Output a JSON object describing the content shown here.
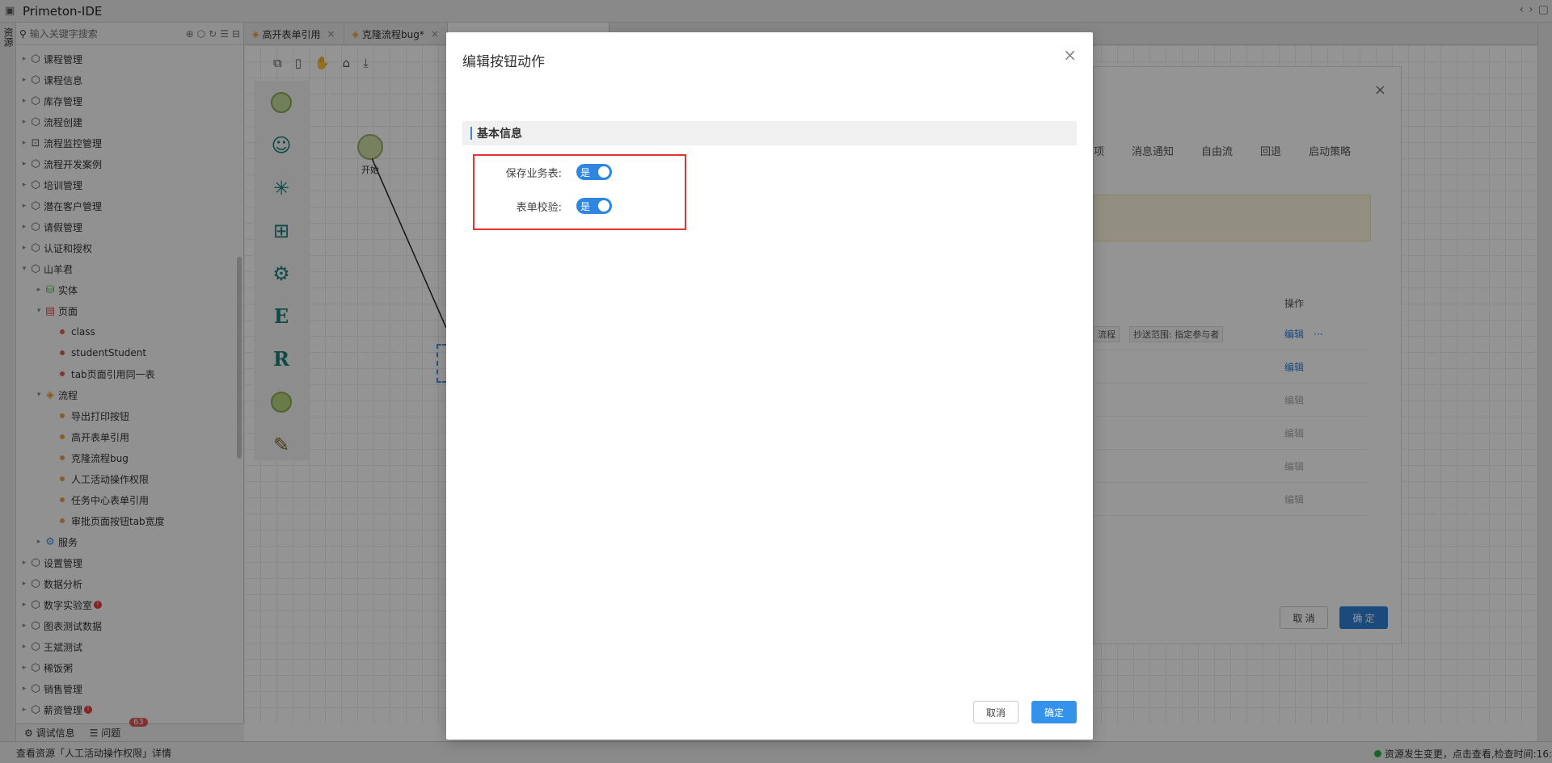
{
  "app": {
    "title": "Primeton-IDE"
  },
  "vtab": {
    "label": "资源"
  },
  "search": {
    "placeholder": "输入关键字搜索"
  },
  "tree": [
    {
      "label": "课程管理",
      "level": 0,
      "kind": "pkg",
      "caret": "right"
    },
    {
      "label": "课程信息",
      "level": 0,
      "kind": "pkg",
      "caret": "right"
    },
    {
      "label": "库存管理",
      "level": 0,
      "kind": "pkg",
      "caret": "right"
    },
    {
      "label": "流程创建",
      "level": 0,
      "kind": "pkg",
      "caret": "right"
    },
    {
      "label": "流程监控管理",
      "level": 0,
      "kind": "monitor",
      "caret": "right"
    },
    {
      "label": "流程开发案例",
      "level": 0,
      "kind": "pkg",
      "caret": "right"
    },
    {
      "label": "培训管理",
      "level": 0,
      "kind": "pkg",
      "caret": "right"
    },
    {
      "label": "潜在客户管理",
      "level": 0,
      "kind": "pkg",
      "caret": "right"
    },
    {
      "label": "请假管理",
      "level": 0,
      "kind": "pkg",
      "caret": "right"
    },
    {
      "label": "认证和授权",
      "level": 0,
      "kind": "pkg",
      "caret": "right"
    },
    {
      "label": "山羊君",
      "level": 0,
      "kind": "pkg",
      "caret": "down"
    },
    {
      "label": "实体",
      "level": 1,
      "kind": "db",
      "caret": "right"
    },
    {
      "label": "页面",
      "level": 1,
      "kind": "page",
      "caret": "down"
    },
    {
      "label": "class",
      "level": 2,
      "kind": "dot-red"
    },
    {
      "label": "studentStudent",
      "level": 2,
      "kind": "dot-red"
    },
    {
      "label": "tab页面引用同一表",
      "level": 2,
      "kind": "dot-red"
    },
    {
      "label": "流程",
      "level": 1,
      "kind": "flow",
      "caret": "down"
    },
    {
      "label": "导出打印按钮",
      "level": 2,
      "kind": "dot-orange"
    },
    {
      "label": "高开表单引用",
      "level": 2,
      "kind": "dot-orange"
    },
    {
      "label": "克隆流程bug",
      "level": 2,
      "kind": "dot-orange"
    },
    {
      "label": "人工活动操作权限",
      "level": 2,
      "kind": "dot-orange"
    },
    {
      "label": "任务中心表单引用",
      "level": 2,
      "kind": "dot-orange"
    },
    {
      "label": "审批页面按钮tab宽度",
      "level": 2,
      "kind": "dot-orange"
    },
    {
      "label": "服务",
      "level": 1,
      "kind": "gear",
      "caret": "right"
    },
    {
      "label": "设置管理",
      "level": 0,
      "kind": "pkg",
      "caret": "right"
    },
    {
      "label": "数据分析",
      "level": 0,
      "kind": "pkg",
      "caret": "right"
    },
    {
      "label": "数字实验室",
      "level": 0,
      "kind": "pkg",
      "caret": "right",
      "badge": "!"
    },
    {
      "label": "图表测试数据",
      "level": 0,
      "kind": "pkg",
      "caret": "right"
    },
    {
      "label": "王斌测试",
      "level": 0,
      "kind": "pkg",
      "caret": "right"
    },
    {
      "label": "稀饭粥",
      "level": 0,
      "kind": "pkg",
      "caret": "right"
    },
    {
      "label": "销售管理",
      "level": 0,
      "kind": "pkg",
      "caret": "right"
    },
    {
      "label": "薪资管理",
      "level": 0,
      "kind": "pkg",
      "caret": "right",
      "badge": "!"
    }
  ],
  "bottom": {
    "debug": "调试信息",
    "problems": "问题",
    "problems_count": "63"
  },
  "status": {
    "left": "查看资源「人工活动操作权限」详情",
    "right": "资源发生变更，点击查看,检查时间:16:"
  },
  "editor_tabs": [
    {
      "label": "高开表单引用",
      "close": "×"
    },
    {
      "label": "克隆流程bug*",
      "close": "×"
    }
  ],
  "canvas": {
    "start_label": "开始"
  },
  "under_dialog": {
    "tabs": [
      "项",
      "消息通知",
      "自由流",
      "回退",
      "启动策略"
    ],
    "col_header": "操作",
    "row1_chip1": "流程",
    "row1_chip2": "抄送范围: 指定参与者",
    "link_edit": "编辑",
    "more": "···",
    "cancel": "取 消",
    "ok": "确 定"
  },
  "dialog": {
    "title": "编辑按钮动作",
    "close": "×",
    "section": "基本信息",
    "fields": [
      {
        "label": "保存业务表:",
        "value": "是"
      },
      {
        "label": "表单校验:",
        "value": "是"
      }
    ],
    "cancel": "取消",
    "ok": "确定"
  },
  "colors": {
    "accent": "#3492ea",
    "highlight": "#e53333",
    "overlay": "rgba(0,0,0,0.42)"
  }
}
